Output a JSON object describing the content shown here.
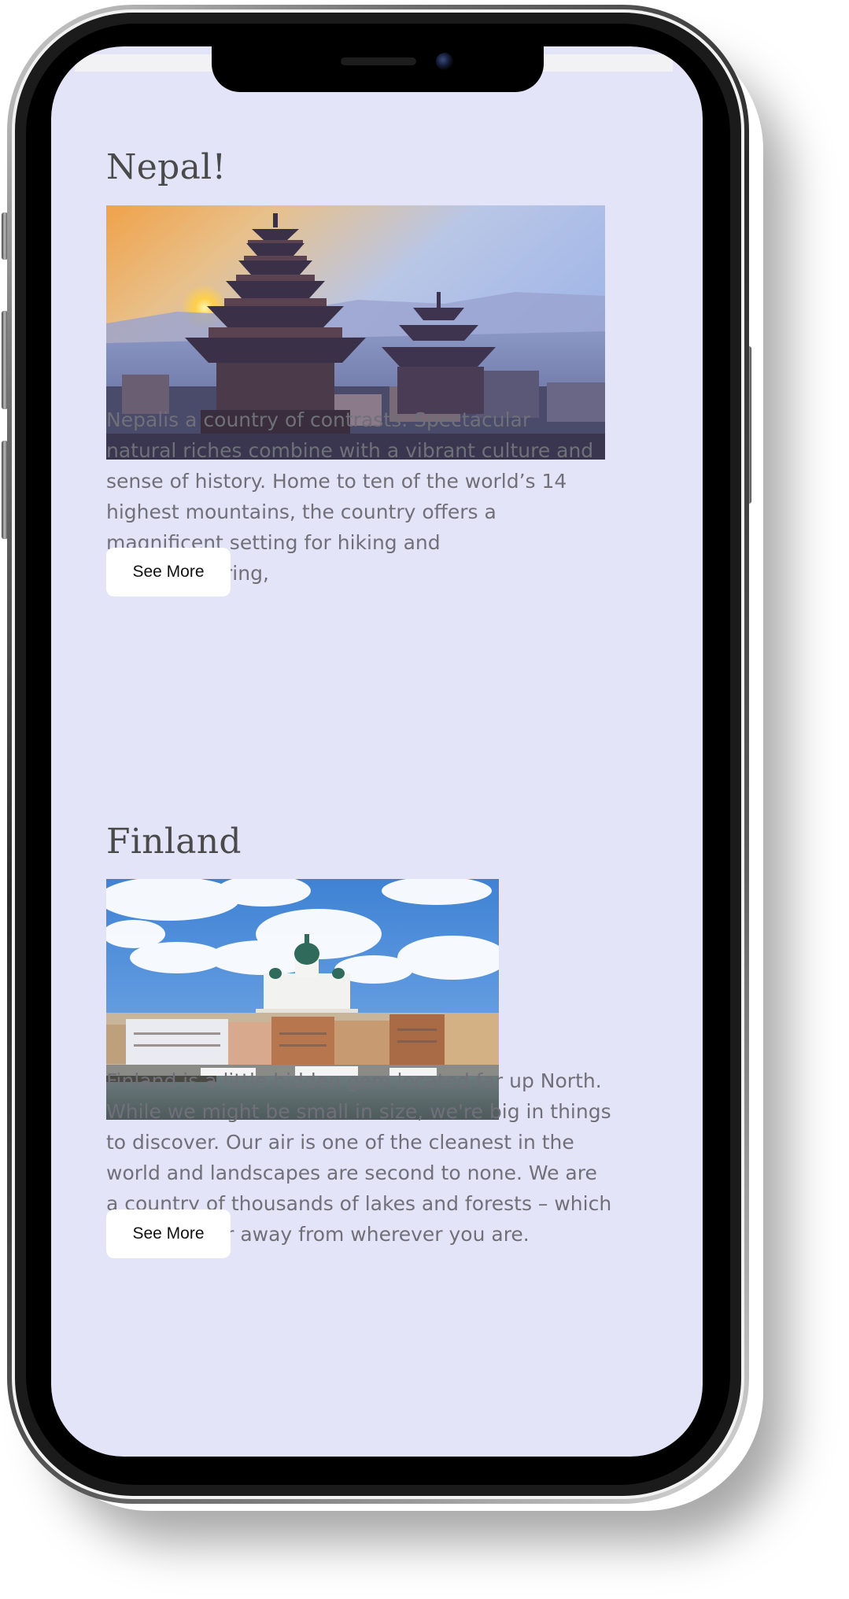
{
  "sections": [
    {
      "title": "Nepal!",
      "image_alt": "Nepal temples at sunset",
      "description": "Nepalis a country of contrasts. Spectacular natural riches combine with a vibrant culture and sense of history. Home to ten of the world’s 14 highest mountains, the country offers a magnificent setting for hiking and mountaineering,",
      "button_label": "See More"
    },
    {
      "title": "Finland",
      "image_alt": "Helsinki harbour and cathedral",
      "description": "Finland is a little hidden gem located far up North. While we might be small in size, we're big in things to discover. Our air is one of the cleanest in the world and landscapes are second to none. We are a country of thousands of lakes and forests – which are never far away from wherever you are.",
      "button_label": "See More"
    }
  ],
  "colors": {
    "screen_background": "#e4e4f8",
    "heading": "#4a4a4a",
    "body_text": "#707078",
    "button_background": "#ffffff",
    "button_text": "#111111"
  }
}
